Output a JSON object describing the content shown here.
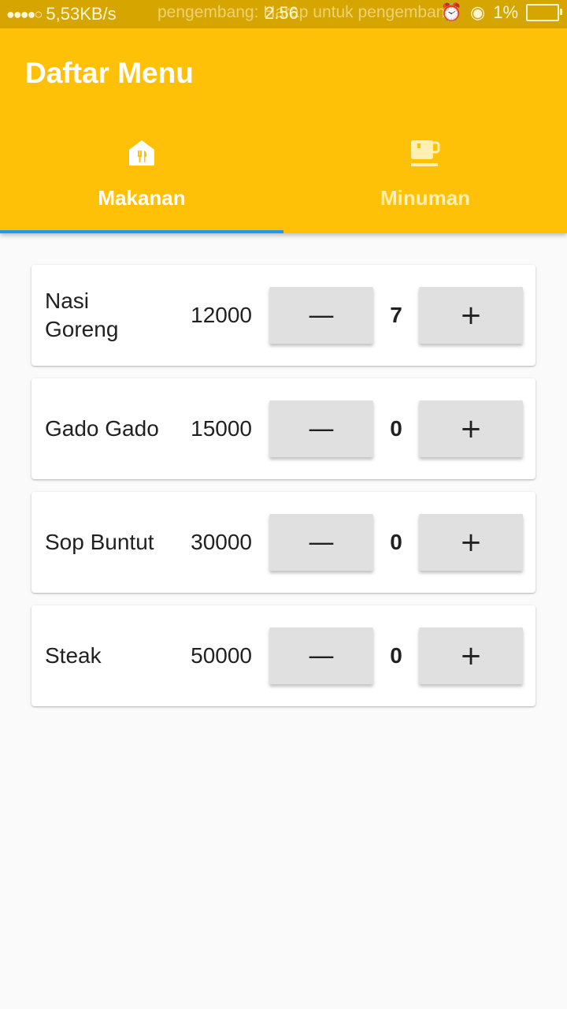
{
  "status_bar": {
    "signal": "●●●●○",
    "network_speed": "5,53KB/s",
    "notice": "pengembang: Harap untuk pengembang",
    "time": "2.56",
    "battery": "1%"
  },
  "app_bar": {
    "title": "Daftar Menu"
  },
  "tabs": [
    {
      "label": "Makanan",
      "icon": "restaurant-icon",
      "active": true
    },
    {
      "label": "Minuman",
      "icon": "cup-icon",
      "active": false
    }
  ],
  "menu_items": [
    {
      "name": "Nasi Goreng",
      "price": "12000",
      "quantity": "7"
    },
    {
      "name": "Gado Gado",
      "price": "15000",
      "quantity": "0"
    },
    {
      "name": "Sop Buntut",
      "price": "30000",
      "quantity": "0"
    },
    {
      "name": "Steak",
      "price": "50000",
      "quantity": "0"
    }
  ],
  "buttons": {
    "decrement_label": "—",
    "increment_label": "+"
  },
  "colors": {
    "app_bar": "#ffc107",
    "status_bar": "#d6a500",
    "tab_indicator": "#2196f3",
    "button": "#e0e0e0"
  }
}
